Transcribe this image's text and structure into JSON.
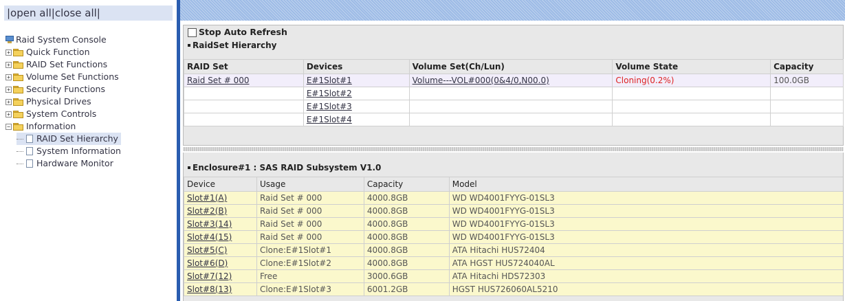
{
  "nav": {
    "open_all": "|open all",
    "close_all": "|close all|",
    "root": "Raid System Console",
    "folders": [
      {
        "label": "Quick Function",
        "expanded": false
      },
      {
        "label": "RAID Set Functions",
        "expanded": false
      },
      {
        "label": "Volume Set Functions",
        "expanded": false
      },
      {
        "label": "Security Functions",
        "expanded": false
      },
      {
        "label": "Physical Drives",
        "expanded": false
      },
      {
        "label": "System Controls",
        "expanded": false
      },
      {
        "label": "Information",
        "expanded": true
      }
    ],
    "info_children": [
      "RAID Set Hierarchy",
      "System Information",
      "Hardware Monitor"
    ]
  },
  "panel": {
    "stop_auto_refresh": "Stop Auto Refresh",
    "raidset_title": "RaidSet Hierarchy",
    "raidset_headers": [
      "RAID Set",
      "Devices",
      "Volume Set(Ch/Lun)",
      "Volume State",
      "Capacity"
    ],
    "raidset_rows": [
      [
        "Raid Set # 000",
        "E#1Slot#1",
        "Volume---VOL#000(0&4/0,N00.0)",
        "Cloning(0.2%)",
        "100.0GB"
      ],
      [
        "",
        "E#1Slot#2",
        "",
        "",
        ""
      ],
      [
        "",
        "E#1Slot#3",
        "",
        "",
        ""
      ],
      [
        "",
        "E#1Slot#4",
        "",
        "",
        ""
      ]
    ],
    "enclosure_title": "Enclosure#1 : SAS RAID Subsystem V1.0",
    "enclosure_headers": [
      "Device",
      "Usage",
      "Capacity",
      "Model"
    ],
    "enclosure_rows": [
      [
        "Slot#1(A)",
        "Raid Set # 000",
        "4000.8GB",
        "WD WD4001FYYG-01SL3"
      ],
      [
        "Slot#2(B)",
        "Raid Set # 000",
        "4000.8GB",
        "WD WD4001FYYG-01SL3"
      ],
      [
        "Slot#3(14)",
        "Raid Set # 000",
        "4000.8GB",
        "WD WD4001FYYG-01SL3"
      ],
      [
        "Slot#4(15)",
        "Raid Set # 000",
        "4000.8GB",
        "WD WD4001FYYG-01SL3"
      ],
      [
        "Slot#5(C)",
        "Clone:E#1Slot#1",
        "4000.8GB",
        "ATA Hitachi HUS72404"
      ],
      [
        "Slot#6(D)",
        "Clone:E#1Slot#2",
        "4000.8GB",
        "ATA HGST HUS724040AL"
      ],
      [
        "Slot#7(12)",
        "Free",
        "3000.6GB",
        "ATA Hitachi HDS72303"
      ],
      [
        "Slot#8(13)",
        "Clone:E#1Slot#3",
        "6001.2GB",
        "HGST HUS726060AL5210"
      ]
    ]
  }
}
